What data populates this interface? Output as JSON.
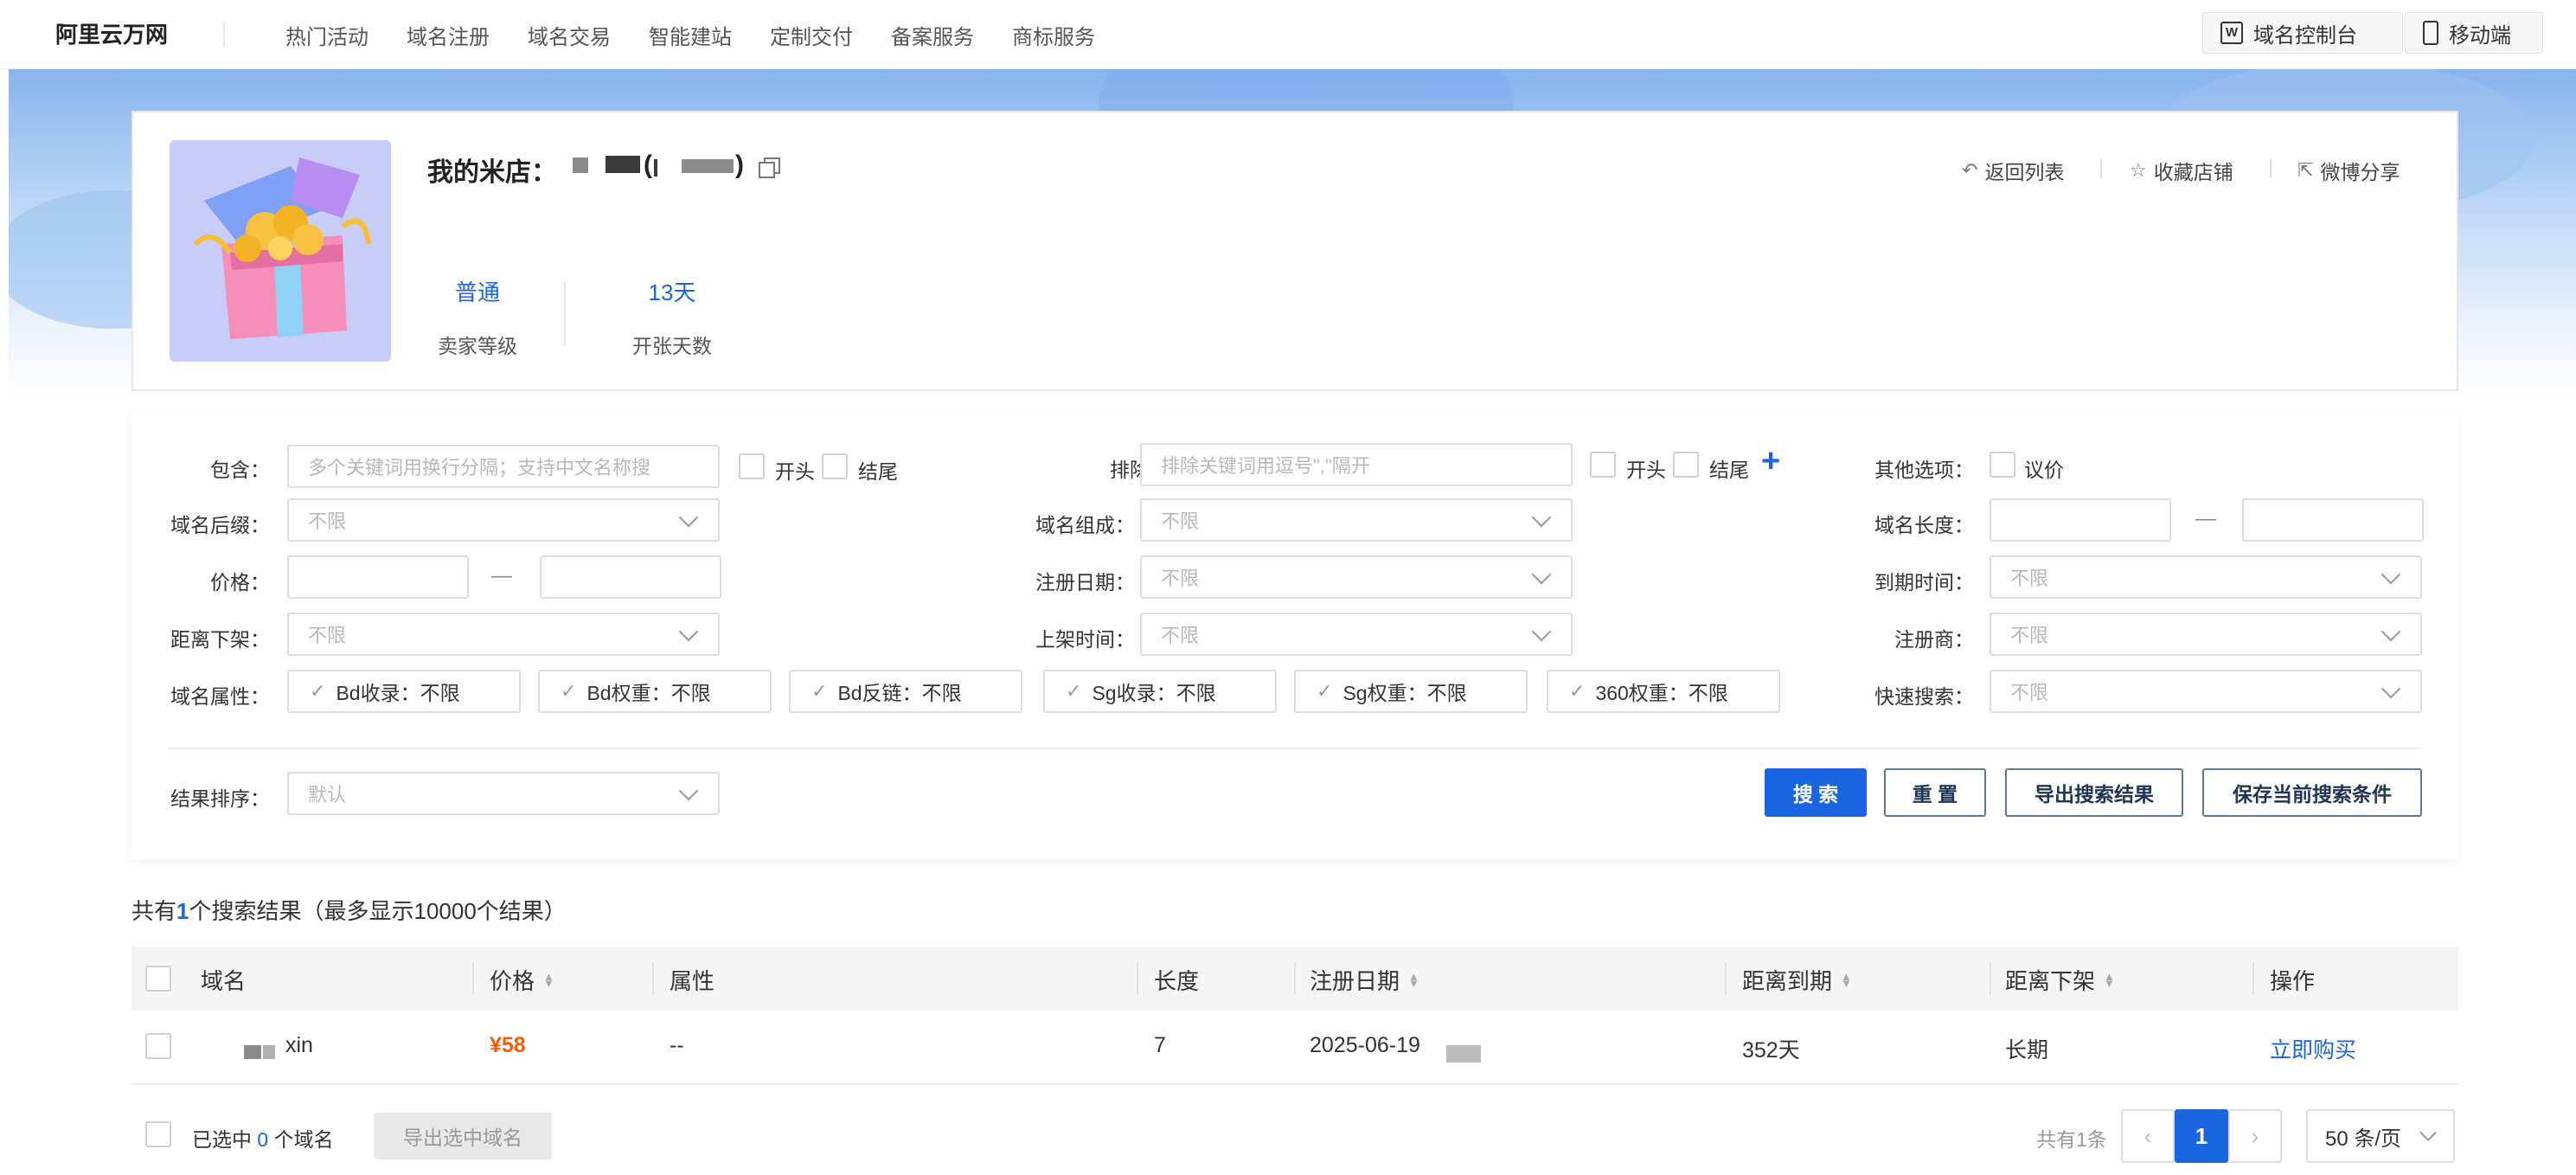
{
  "nav": {
    "brand": "阿里云万网",
    "items": [
      "热门活动",
      "域名注册",
      "域名交易",
      "智能建站",
      "定制交付",
      "备案服务",
      "商标服务"
    ],
    "console_label": "域名控制台",
    "console_icon_text": "W",
    "mobile_label": "移动端"
  },
  "shop": {
    "title": "我的米店：",
    "bracket_open": "(",
    "bracket_close": ")",
    "level_value": "普通",
    "level_label": "卖家等级",
    "days_value": "13天",
    "days_label": "开张天数",
    "actions": [
      "返回列表",
      "收藏店铺",
      "微博分享"
    ]
  },
  "filter": {
    "include_label": "包含：",
    "include_placeholder": "多个关键词用换行分隔；支持中文名称搜",
    "start_label": "开头",
    "end_label": "结尾",
    "exclude_label": "排除：",
    "exclude_placeholder": "排除关键词用逗号\",\"隔开",
    "other_label": "其他选项：",
    "negotiable_label": "议价",
    "suffix_label": "域名后缀：",
    "composition_label": "域名组成：",
    "length_label": "域名长度：",
    "price_label": "价格：",
    "regdate_label": "注册日期：",
    "expire_label": "到期时间：",
    "delist_label": "距离下架：",
    "listtime_label": "上架时间：",
    "registrar_label": "注册商：",
    "attr_label": "域名属性：",
    "quick_label": "快速搜索：",
    "sort_label": "结果排序：",
    "unlimited": "不限",
    "default_sort": "默认",
    "dash": "—",
    "attrs": [
      "Bd收录：不限",
      "Bd权重：不限",
      "Bd反链：不限",
      "Sg收录：不限",
      "Sg权重：不限",
      "360权重：不限"
    ],
    "search_btn": "搜 索",
    "reset_btn": "重 置",
    "export_btn": "导出搜索结果",
    "save_btn": "保存当前搜索条件"
  },
  "results": {
    "count_prefix": "共有",
    "count": "1",
    "count_suffix": "个搜索结果（最多显示10000个结果）",
    "columns": [
      "域名",
      "价格",
      "属性",
      "长度",
      "注册日期",
      "距离到期",
      "距离下架",
      "操作"
    ],
    "rows": [
      {
        "domain_suffix": "xin",
        "price": "¥58",
        "attr": "--",
        "length": "7",
        "reg_date": "2025-06-19",
        "to_expire": "352天",
        "to_delist": "长期",
        "action": "立即购买"
      }
    ]
  },
  "footer": {
    "selected_prefix": "已选中",
    "selected_count": "0",
    "selected_suffix": "个域名",
    "export_selected": "导出选中域名",
    "total": "共有1条",
    "current_page": "1",
    "per_page": "50 条/页"
  }
}
